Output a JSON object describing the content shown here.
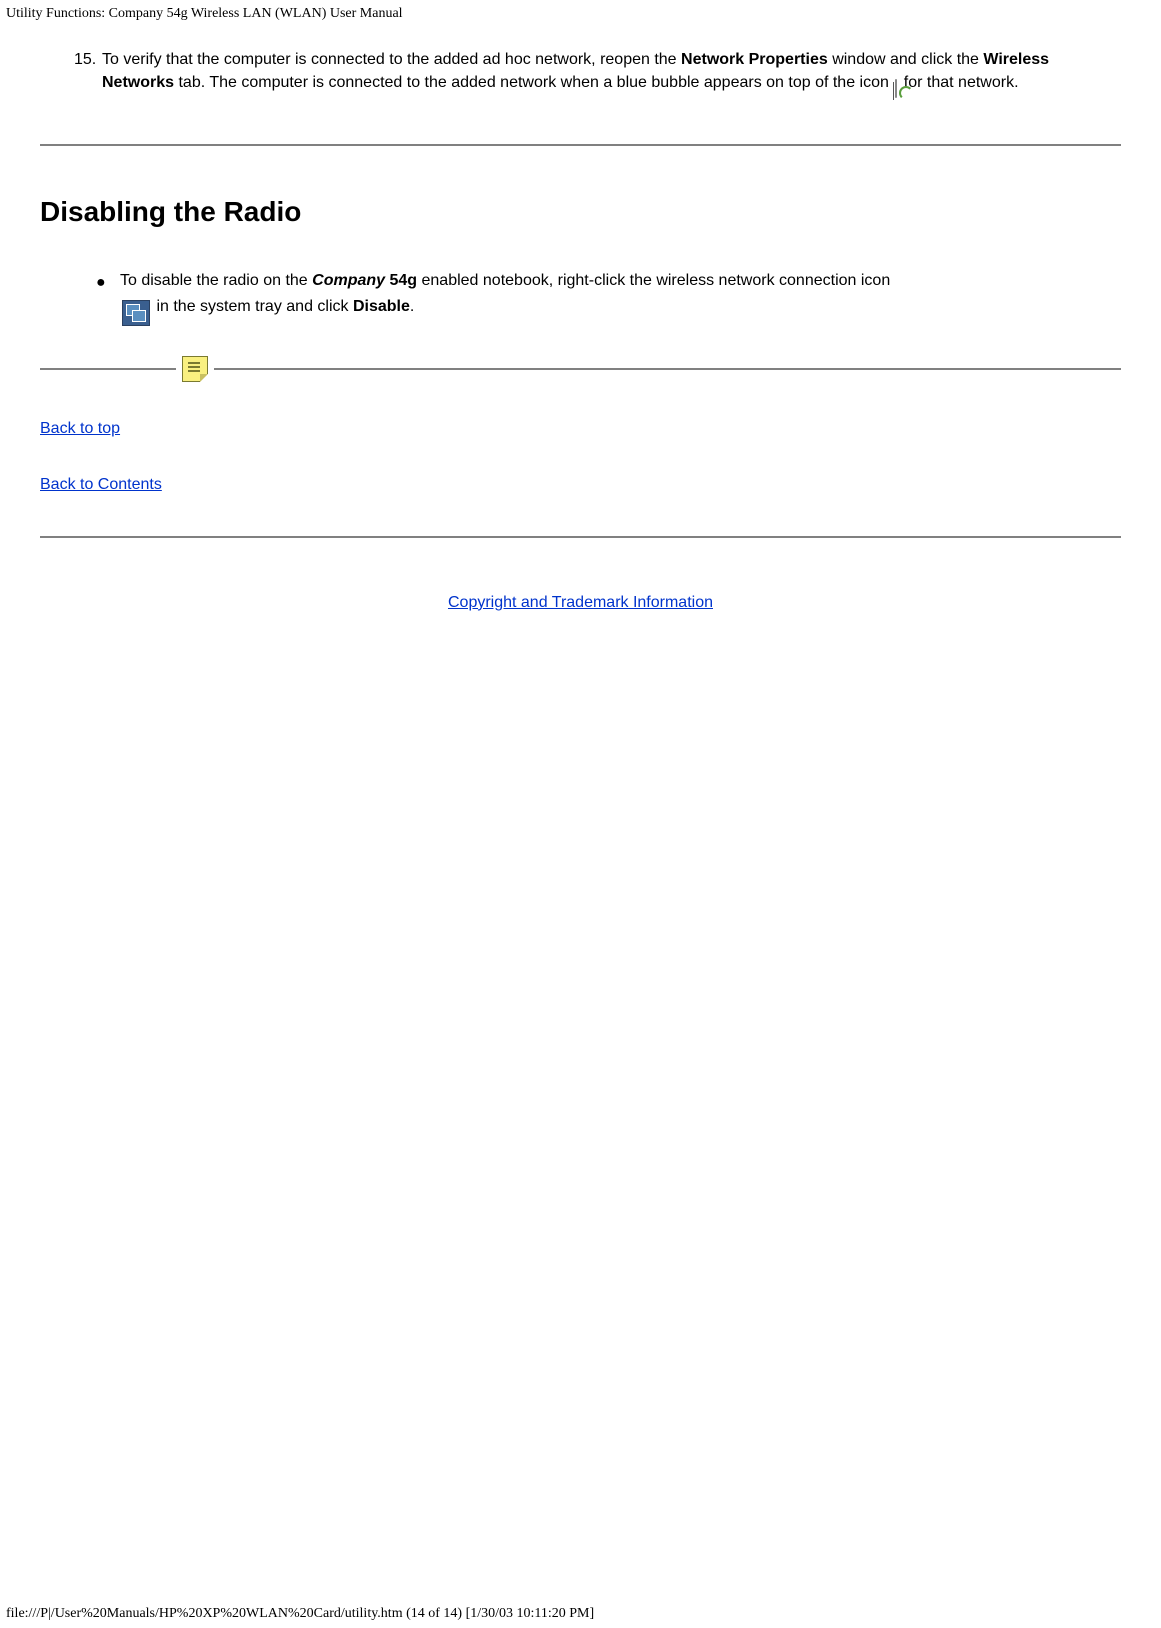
{
  "header": {
    "title": "Utility Functions: Company 54g Wireless LAN (WLAN) User Manual"
  },
  "step15": {
    "number": "15.",
    "text_part1": "To verify that the computer is connected to the added ad hoc network, reopen the ",
    "bold1": "Network Properties",
    "text_part2": " window and click the ",
    "bold2": "Wireless Networks",
    "text_part3": " tab. The computer is connected to the added network when a blue bubble appears on top of the icon ",
    "text_part4": " for that network."
  },
  "section": {
    "heading": "Disabling the Radio"
  },
  "bullet": {
    "text_part1": "To disable the radio on the ",
    "italic_bold": "Company",
    "bold1": " 54g",
    "text_part2": " enabled notebook, right-click the wireless network connection icon ",
    "text_part3": " in the system tray and click ",
    "bold2": "Disable",
    "text_part4": "."
  },
  "links": {
    "back_to_top": "Back to top",
    "back_to_contents": "Back to Contents",
    "copyright": "Copyright and Trademark Information"
  },
  "footer": {
    "path": "file:///P|/User%20Manuals/HP%20XP%20WLAN%20Card/utility.htm (14 of 14) [1/30/03 10:11:20 PM]"
  },
  "icons": {
    "signal": "signal-icon",
    "network": "network-connection-icon",
    "note": "note-icon"
  }
}
